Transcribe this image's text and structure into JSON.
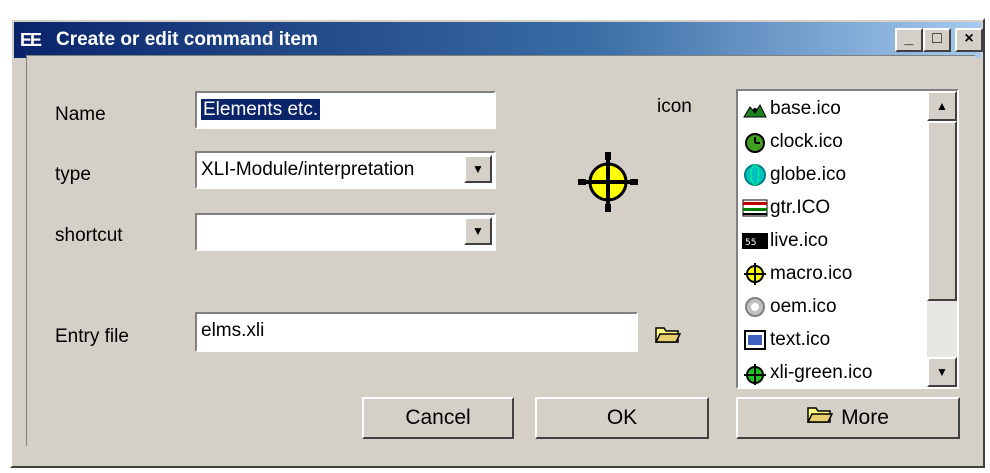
{
  "window": {
    "title": "Create or edit command item",
    "title_icon_text": "EE",
    "controls": {
      "minimize": "_",
      "maximize": "□",
      "close": "×"
    }
  },
  "form": {
    "name_label": "Name",
    "name_value": "Elements etc.",
    "type_label": "type",
    "type_value": "XLI-Module/interpretation",
    "shortcut_label": "shortcut",
    "shortcut_value": "",
    "entry_label": "Entry file",
    "entry_value": "elms.xli",
    "icon_label": "icon"
  },
  "icon_list": {
    "items": [
      "base.ico",
      "clock.ico",
      "globe.ico",
      "gtr.ICO",
      "live.ico",
      "macro.ico",
      "oem.ico",
      "text.ico",
      "xli-green.ico"
    ]
  },
  "buttons": {
    "cancel": "Cancel",
    "ok": "OK",
    "more": "More"
  },
  "colors": {
    "title_start": "#0a246a",
    "title_end": "#a6caf0",
    "face": "#d4d0c8",
    "selection": "#0a246a"
  }
}
